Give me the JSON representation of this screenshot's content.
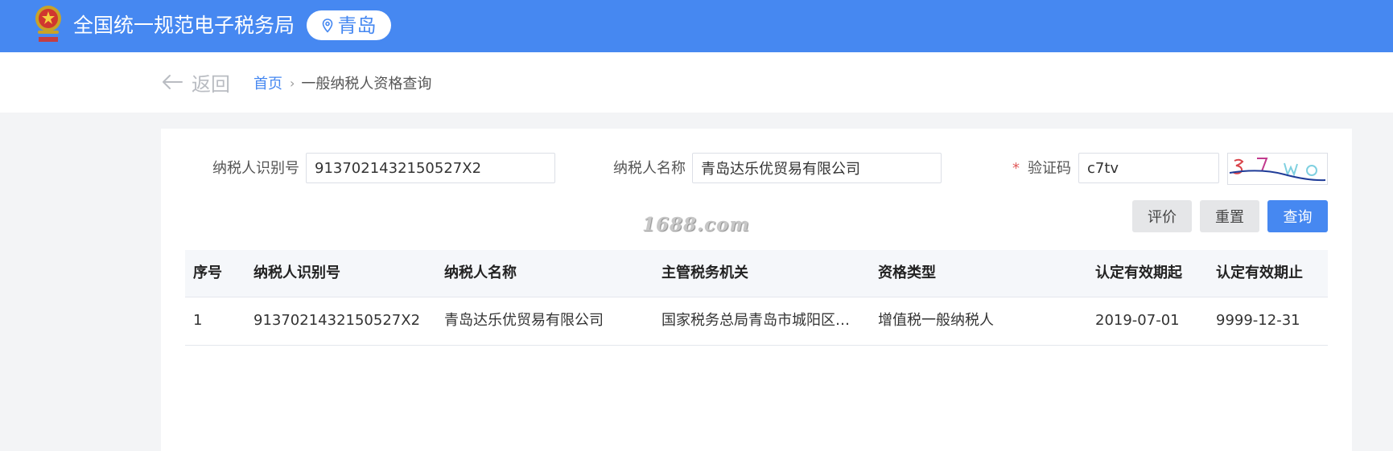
{
  "header": {
    "title": "全国统一规范电子税务局",
    "city": "青岛",
    "icons": {
      "emblem": "national-tax-emblem",
      "city": "location-pin-icon"
    },
    "colors": {
      "header_bg": "#4688f1",
      "accent": "#4688f1"
    }
  },
  "nav": {
    "back_label": "返回",
    "breadcrumb": {
      "home": "首页",
      "separator": "›",
      "current": "一般纳税人资格查询"
    }
  },
  "form": {
    "taxpayer_id_label": "纳税人识别号",
    "taxpayer_id_value": "9137021432150527X2",
    "taxpayer_name_label": "纳税人名称",
    "taxpayer_name_value": "青岛达乐优贸易有限公司",
    "captcha_required_mark": "*",
    "captcha_label": "验证码",
    "captcha_value": "c7tv"
  },
  "actions": {
    "evaluate": "评价",
    "reset": "重置",
    "query": "查询"
  },
  "watermark": "1688.com",
  "table": {
    "headers": [
      "序号",
      "纳税人识别号",
      "纳税人名称",
      "主管税务机关",
      "资格类型",
      "认定有效期起",
      "认定有效期止"
    ],
    "rows": [
      [
        "1",
        "9137021432150527X2",
        "青岛达乐优贸易有限公司",
        "国家税务总局青岛市城阳区税...",
        "增值税一般纳税人",
        "2019-07-01",
        "9999-12-31"
      ]
    ]
  }
}
